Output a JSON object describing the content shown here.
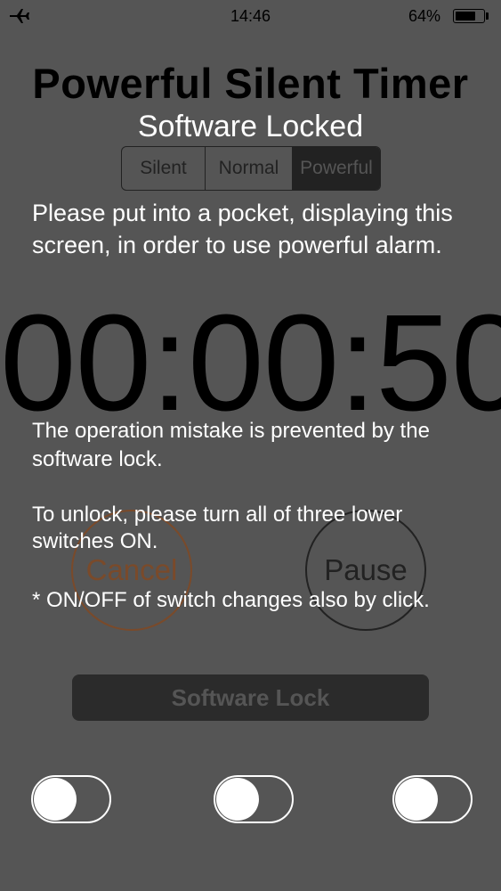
{
  "status_bar": {
    "time": "14:46",
    "battery_percent": "64%",
    "battery_level": 0.64,
    "airplane_icon": "airplane-icon"
  },
  "header": {
    "title": "Powerful Silent Timer",
    "subtitle": "Software Locked"
  },
  "mode_selector": {
    "options": [
      "Silent",
      "Normal",
      "Powerful"
    ],
    "selected": "Powerful"
  },
  "instructions": {
    "pocket": "Please put into a pocket, displaying this screen, in order to use powerful alarm."
  },
  "timer": {
    "display": "00:00:50"
  },
  "lock_info": {
    "mistake": "The operation mistake is prevented by the software lock.",
    "unlock": "To unlock, please turn all of three lower switches ON.",
    "click_note": "* ON/OFF of switch changes also by click."
  },
  "controls": {
    "cancel_label": "Cancel",
    "pause_label": "Pause",
    "software_lock_label": "Software Lock"
  },
  "switches": [
    {
      "state": "off"
    },
    {
      "state": "off"
    },
    {
      "state": "off"
    }
  ]
}
